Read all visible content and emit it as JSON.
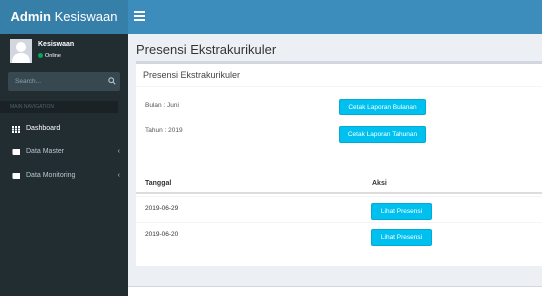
{
  "header": {
    "logo_bold": "Admin",
    "logo_rest": " Kesiswaan",
    "menu_toggle_icon": "hamburger-icon"
  },
  "sidebar": {
    "user": {
      "name": "Kesiswaan",
      "status": "Online",
      "status_color": "#00a65a"
    },
    "search": {
      "placeholder": "Search...",
      "icon": "search-icon"
    },
    "nav_header": "MAIN NAVIGATION",
    "items": [
      {
        "label": "Dashboard",
        "icon": "dashboard-icon",
        "has_chevron": false
      },
      {
        "label": "Data Master",
        "icon": "book-icon",
        "has_chevron": true,
        "chevron": "‹"
      },
      {
        "label": "Data Monitoring",
        "icon": "book-icon",
        "has_chevron": true,
        "chevron": "‹"
      }
    ]
  },
  "page": {
    "title": "Presensi Ekstrakurikuler",
    "box_title": "Presensi Ekstrakurikuler",
    "month_label": "Bulan : Juni",
    "year_label": "Tahun : 2019",
    "monthly_report_button": "Cetak Laporan Bulanan",
    "yearly_report_button": "Cetak Laporan Tahunan",
    "table": {
      "columns": [
        "Tanggal",
        "Aksi"
      ],
      "rows": [
        {
          "date": "2019-06-29",
          "action": "Lihat Presensi"
        },
        {
          "date": "2019-06-20",
          "action": "Lihat Presensi"
        }
      ]
    }
  },
  "colors": {
    "topbar": "#3c8dbc",
    "logo_bg": "#367fa9",
    "sidebar_bg": "#222d32",
    "button_info": "#00c0ef",
    "content_bg": "#ecf0f5"
  }
}
